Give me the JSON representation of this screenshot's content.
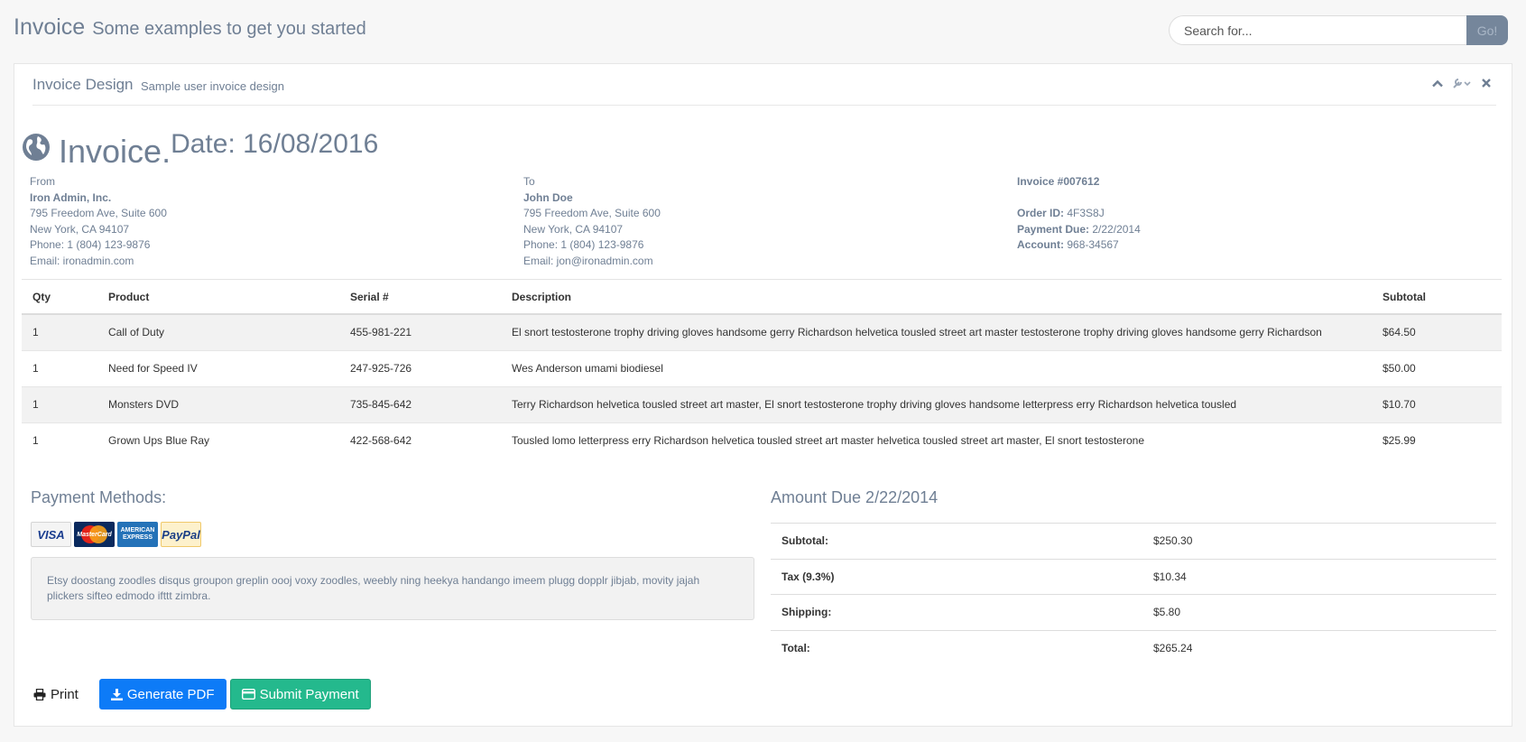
{
  "header": {
    "title": "Invoice",
    "subtitle": "Some examples to get you started"
  },
  "search": {
    "placeholder": "Search for...",
    "button_label": "Go!"
  },
  "panel": {
    "title": "Invoice Design",
    "subtitle": "Sample user invoice design"
  },
  "invoice": {
    "heading": "Invoice.",
    "date_label": "Date: 16/08/2016"
  },
  "from": {
    "label": "From",
    "name": "Iron Admin, Inc.",
    "street": "795 Freedom Ave, Suite 600",
    "city": "New York, CA 94107",
    "phone": "Phone: 1 (804) 123-9876",
    "email": "Email: ironadmin.com"
  },
  "to": {
    "label": "To",
    "name": "John Doe",
    "street": "795 Freedom Ave, Suite 600",
    "city": "New York, CA 94107",
    "phone": "Phone: 1 (804) 123-9876",
    "email": "Email: jon@ironadmin.com"
  },
  "meta": {
    "invoice_no": "Invoice #007612",
    "order_label": "Order ID:",
    "order_value": "4F3S8J",
    "due_label": "Payment Due:",
    "due_value": "2/22/2014",
    "account_label": "Account:",
    "account_value": "968-34567"
  },
  "items": {
    "headers": [
      "Qty",
      "Product",
      "Serial #",
      "Description",
      "Subtotal"
    ],
    "rows": [
      [
        "1",
        "Call of Duty",
        "455-981-221",
        "El snort testosterone trophy driving gloves handsome gerry Richardson helvetica tousled street art master testosterone trophy driving gloves handsome gerry Richardson",
        "$64.50"
      ],
      [
        "1",
        "Need for Speed IV",
        "247-925-726",
        "Wes Anderson umami biodiesel",
        "$50.00"
      ],
      [
        "1",
        "Monsters DVD",
        "735-845-642",
        "Terry Richardson helvetica tousled street art master, El snort testosterone trophy driving gloves handsome letterpress erry Richardson helvetica tousled",
        "$10.70"
      ],
      [
        "1",
        "Grown Ups Blue Ray",
        "422-568-642",
        "Tousled lomo letterpress erry Richardson helvetica tousled street art master helvetica tousled street art master, El snort testosterone",
        "$25.99"
      ]
    ]
  },
  "payment": {
    "title": "Payment Methods:",
    "cards": [
      "VISA",
      "MasterCard",
      "AMERICAN EXPRESS",
      "PayPal"
    ],
    "note": "Etsy doostang zoodles disqus groupon greplin oooj voxy zoodles, weebly ning heekya handango imeem plugg dopplr jibjab, movity jajah plickers sifteo edmodo ifttt zimbra."
  },
  "amount": {
    "title": "Amount Due 2/22/2014",
    "rows": [
      [
        "Subtotal:",
        "$250.30"
      ],
      [
        "Tax (9.3%)",
        "$10.34"
      ],
      [
        "Shipping:",
        "$5.80"
      ],
      [
        "Total:",
        "$265.24"
      ]
    ]
  },
  "actions": {
    "print": "Print",
    "pdf": "Generate PDF",
    "pay": "Submit Payment"
  },
  "colors": {
    "accent_text": "#6f7f94",
    "primary": "#0d7bf7",
    "success": "#24b98d"
  }
}
